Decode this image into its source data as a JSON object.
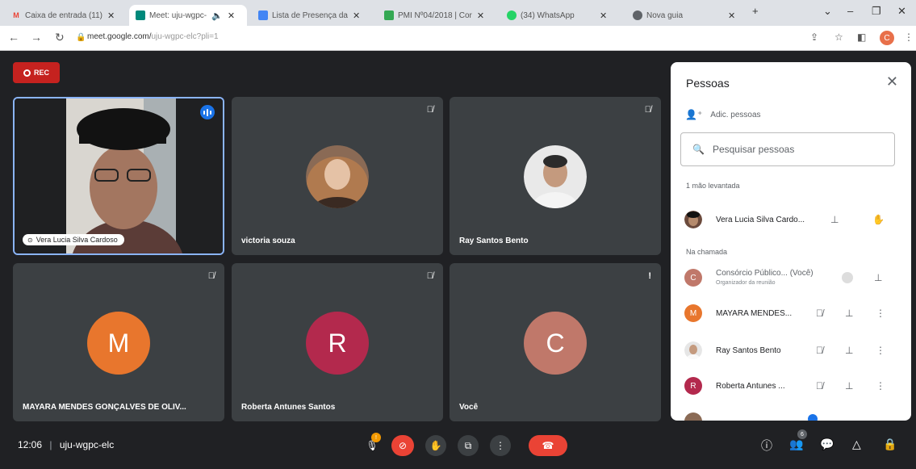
{
  "browser": {
    "tabs": [
      {
        "title": "Caixa de entrada (11)",
        "favicon": "M",
        "color": "#ea4335"
      },
      {
        "title": "Meet: uju-wgpc-",
        "favicon": "",
        "color": "#00897b"
      },
      {
        "title": "Lista de Presença da",
        "favicon": "",
        "color": "#4285f4"
      },
      {
        "title": "PMI Nº04/2018 | Cor",
        "favicon": "",
        "color": "#34a853"
      },
      {
        "title": "(34) WhatsApp",
        "favicon": "",
        "color": "#25d366"
      },
      {
        "title": "Nova guia",
        "favicon": "",
        "color": "#5f6368"
      }
    ],
    "url_host": "meet.google.com/",
    "url_path": "uju-wgpc-elc?pli=1",
    "profile_initial": "C"
  },
  "rec_label": "REC",
  "tiles": [
    {
      "name": "Vera Lucia Silva Cardoso"
    },
    {
      "name": "victoria souza"
    },
    {
      "name": "Ray Santos Bento"
    },
    {
      "name": "MAYARA MENDES GONÇALVES DE OLIV...",
      "initial": "M",
      "color": "#e8762d"
    },
    {
      "name": "Roberta Antunes Santos",
      "initial": "R",
      "color": "#b3294d"
    },
    {
      "name": "Você",
      "initial": "C",
      "color": "#c0786a"
    }
  ],
  "panel": {
    "title": "Pessoas",
    "add_label": "Adic. pessoas",
    "search_placeholder": "Pesquisar pessoas",
    "raised_section": "1 mão levantada",
    "raised_person": "Vera Lucia Silva Cardo...",
    "in_call_section": "Na chamada",
    "people": [
      {
        "name": "Consórcio Público... (Você)",
        "sub": "Organizador da reunião",
        "initial": "C",
        "color": "#c0786a"
      },
      {
        "name": "MAYARA MENDES...",
        "initial": "M",
        "color": "#e8762d"
      },
      {
        "name": "Ray Santos Bento",
        "initial": "",
        "color": "#c9c9c9"
      },
      {
        "name": "Roberta Antunes ...",
        "initial": "R",
        "color": "#b3294d"
      }
    ]
  },
  "bottom": {
    "time": "12:06",
    "separator": "|",
    "meeting_code": "uju-wgpc-elc",
    "people_count": "6"
  }
}
